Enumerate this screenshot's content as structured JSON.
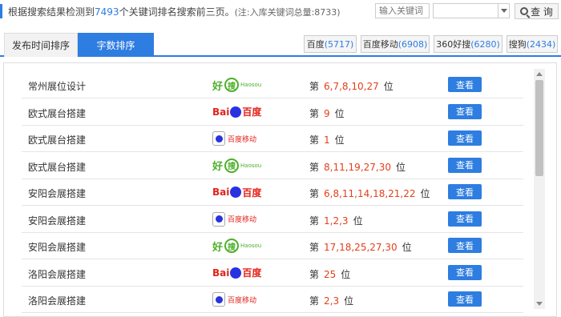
{
  "summary": {
    "prefix": "根据搜索结果检测到",
    "count": "7493",
    "suffix": "个关键词排名搜索前三页。",
    "note": "(注:入库关键词总量:8733)"
  },
  "search": {
    "placeholder": "输入关键词",
    "select_value": "",
    "button_label": "查 询"
  },
  "tabs": [
    {
      "label": "发布时间排序",
      "active": false
    },
    {
      "label": "字数排序",
      "active": true
    }
  ],
  "engines": [
    {
      "name": "百度",
      "count": "(5717)"
    },
    {
      "name": "百度移动",
      "count": "(6908)"
    },
    {
      "name": "360好搜",
      "count": "(6280)"
    },
    {
      "name": "搜狗",
      "count": "(2434)"
    }
  ],
  "rows": [
    {
      "keyword": "常州展位设计",
      "engine": "haosou",
      "rank_prefix": "第",
      "positions": "6,7,8,10,27",
      "rank_suffix": "位",
      "action": "查看"
    },
    {
      "keyword": "欧式展台搭建",
      "engine": "baidu",
      "rank_prefix": "第",
      "positions": "9",
      "rank_suffix": "位",
      "action": "查看"
    },
    {
      "keyword": "欧式展台搭建",
      "engine": "baidu-mobile",
      "rank_prefix": "第",
      "positions": "1",
      "rank_suffix": "位",
      "action": "查看"
    },
    {
      "keyword": "欧式展台搭建",
      "engine": "haosou",
      "rank_prefix": "第",
      "positions": "8,11,19,27,30",
      "rank_suffix": "位",
      "action": "查看"
    },
    {
      "keyword": "安阳会展搭建",
      "engine": "baidu",
      "rank_prefix": "第",
      "positions": "6,8,11,14,18,21,22",
      "rank_suffix": "位",
      "action": "查看"
    },
    {
      "keyword": "安阳会展搭建",
      "engine": "baidu-mobile",
      "rank_prefix": "第",
      "positions": "1,2,3",
      "rank_suffix": "位",
      "action": "查看"
    },
    {
      "keyword": "安阳会展搭建",
      "engine": "haosou",
      "rank_prefix": "第",
      "positions": "17,18,25,27,30",
      "rank_suffix": "位",
      "action": "查看"
    },
    {
      "keyword": "洛阳会展搭建",
      "engine": "baidu",
      "rank_prefix": "第",
      "positions": "25",
      "rank_suffix": "位",
      "action": "查看"
    },
    {
      "keyword": "洛阳会展搭建",
      "engine": "baidu-mobile",
      "rank_prefix": "第",
      "positions": "2,3",
      "rank_suffix": "位",
      "action": "查看"
    }
  ],
  "logos": {
    "haosou": {
      "hao": "好",
      "so": "搜",
      "en": "Haosou"
    },
    "baidu": {
      "bai": "Bai",
      "du": "百度"
    },
    "baidu-mobile": {
      "text": "百度移动"
    }
  },
  "colors": {
    "accent": "#2e7de1",
    "rank": "#e2401c"
  }
}
